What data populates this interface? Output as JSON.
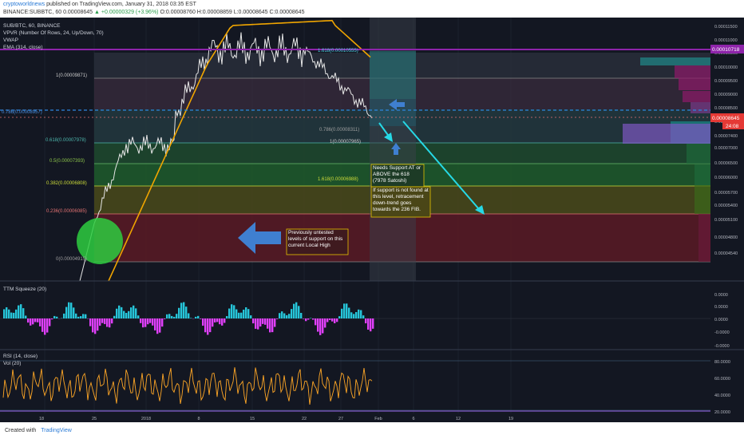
{
  "header": {
    "author": "cryptoworldnews",
    "published": "published on TradingView.com, January 31, 2018 03:35 EST",
    "symbol_line": "BINANCE:SUBBTC, 60  0.00008645",
    "change": "▲ +0.00000329 (+3.96%)",
    "ohlc": "O:0.00008760  H:0.00008859  L:0.00008645  C:0.00008645"
  },
  "footer": {
    "created": "Created with",
    "brand": "TradingView"
  },
  "price_pane": {
    "symbol": "SUB/BTC, 60, BINANCE",
    "indicators": [
      "VPVR (Number Of Rows, 24, Up/Down, 70)",
      "VWAP",
      "EMA (314, close)"
    ],
    "fib_left": [
      {
        "label": "1(0.00009871)"
      },
      {
        "label": "0.786(0.00008957)"
      },
      {
        "label": "0.618(0.00007978)"
      },
      {
        "label": "0.5(0.00007393)"
      },
      {
        "label": "0.382(0.00006808)"
      },
      {
        "label": "0.236(0.00006085)"
      },
      {
        "label": "0(0.00004915)"
      }
    ],
    "fib_right": [
      {
        "label": "1.618(0.00010555)"
      },
      {
        "label": "1.618(0.00006988)"
      },
      {
        "label": "1(0.00007965)"
      },
      {
        "label": "0.786(0.00008311)"
      }
    ],
    "price_axis": [
      "0.00011500",
      "0.00011000",
      "0.00010500",
      "0.00010000",
      "0.00009500",
      "0.00009000",
      "0.00008500",
      "0.00008000",
      "0.00007400",
      "0.00007000",
      "0.00006500",
      "0.00006000",
      "0.00005700",
      "0.00005400",
      "0.00005100",
      "0.00004800",
      "0.00004540"
    ],
    "tags": {
      "purple": "0.00010718",
      "current": "0.00008645",
      "countdown": "24:08"
    },
    "notes": [
      "Needs Support AT or ABOVE the 618 (7978 Satoshi)",
      "If support is not found at this level, retracement down-trend goes towards the 236 FIB.",
      "Previously untested levels of support on this current Local High"
    ]
  },
  "squeeze_pane": {
    "title": "TTM Squeeze (20)",
    "axis": [
      "0.0000",
      "0.0000",
      "0.0000",
      "-0.0000",
      "-0.0000"
    ]
  },
  "rsi_pane": {
    "title": "RSI (14, close)",
    "vol": "Vol (20)",
    "axis": [
      "80.0000",
      "60.0000",
      "40.0000",
      "20.0000"
    ]
  },
  "time_axis": [
    "18",
    "25",
    "2018",
    "8",
    "15",
    "22",
    "27",
    "Feb",
    "6",
    "12",
    "19"
  ],
  "colors": {
    "bg": "#131722",
    "teal": "#26c6da",
    "orange": "#ff9800",
    "purple": "#7b1fa2",
    "magenta": "#e040fb",
    "red_zone": "#7a1f2a",
    "green_zone": "#1e5a2a",
    "yellow_zone": "#4d4a16",
    "dotted_blue": "#2e86de",
    "note_border": "#e6c200"
  },
  "chart_data": {
    "type": "line",
    "series": [],
    "ylim": [
      4.54e-05,
      0.000115
    ],
    "title": "SUB/BTC, 60, BINANCE",
    "xlabel": "",
    "ylabel": ""
  }
}
